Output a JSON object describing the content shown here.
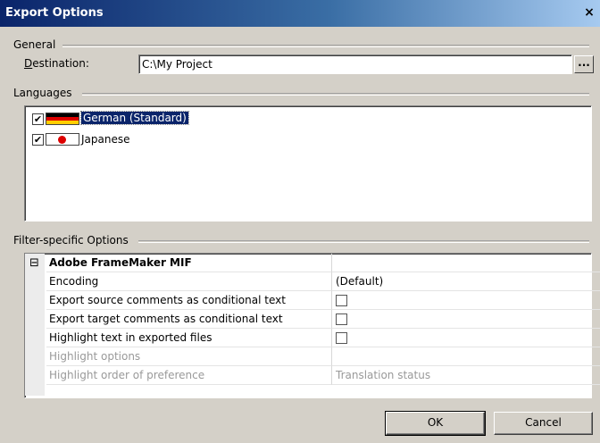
{
  "window": {
    "title": "Export Options",
    "close_glyph": "×"
  },
  "general": {
    "label": "General",
    "destination_label": "Destination:",
    "destination_value": "C:\\My Project",
    "browse_label": "..."
  },
  "languages": {
    "label": "Languages",
    "items": [
      {
        "label": "German (Standard)",
        "checked": true,
        "flag": "flag-germany-icon"
      },
      {
        "label": "Japanese",
        "checked": true,
        "flag": "flag-japan-icon"
      }
    ]
  },
  "filter": {
    "label": "Filter-specific Options",
    "category": "Adobe FrameMaker MIF",
    "expander_glyph": "⊟",
    "rows": [
      {
        "name": "Encoding",
        "value": "(Default)"
      },
      {
        "name": "Export source comments as conditional text",
        "value": ""
      },
      {
        "name": "Export target comments as conditional text",
        "value": ""
      },
      {
        "name": "Highlight text in exported files",
        "value": ""
      },
      {
        "name": "Highlight options",
        "value": ""
      },
      {
        "name": "Highlight order of preference",
        "value": "Translation status"
      }
    ]
  },
  "buttons": {
    "ok": "OK",
    "cancel": "Cancel"
  },
  "colors": {
    "titlebar": "#0a246a",
    "selection": "#0a246a",
    "dialog_bg": "#d4d0c8"
  }
}
